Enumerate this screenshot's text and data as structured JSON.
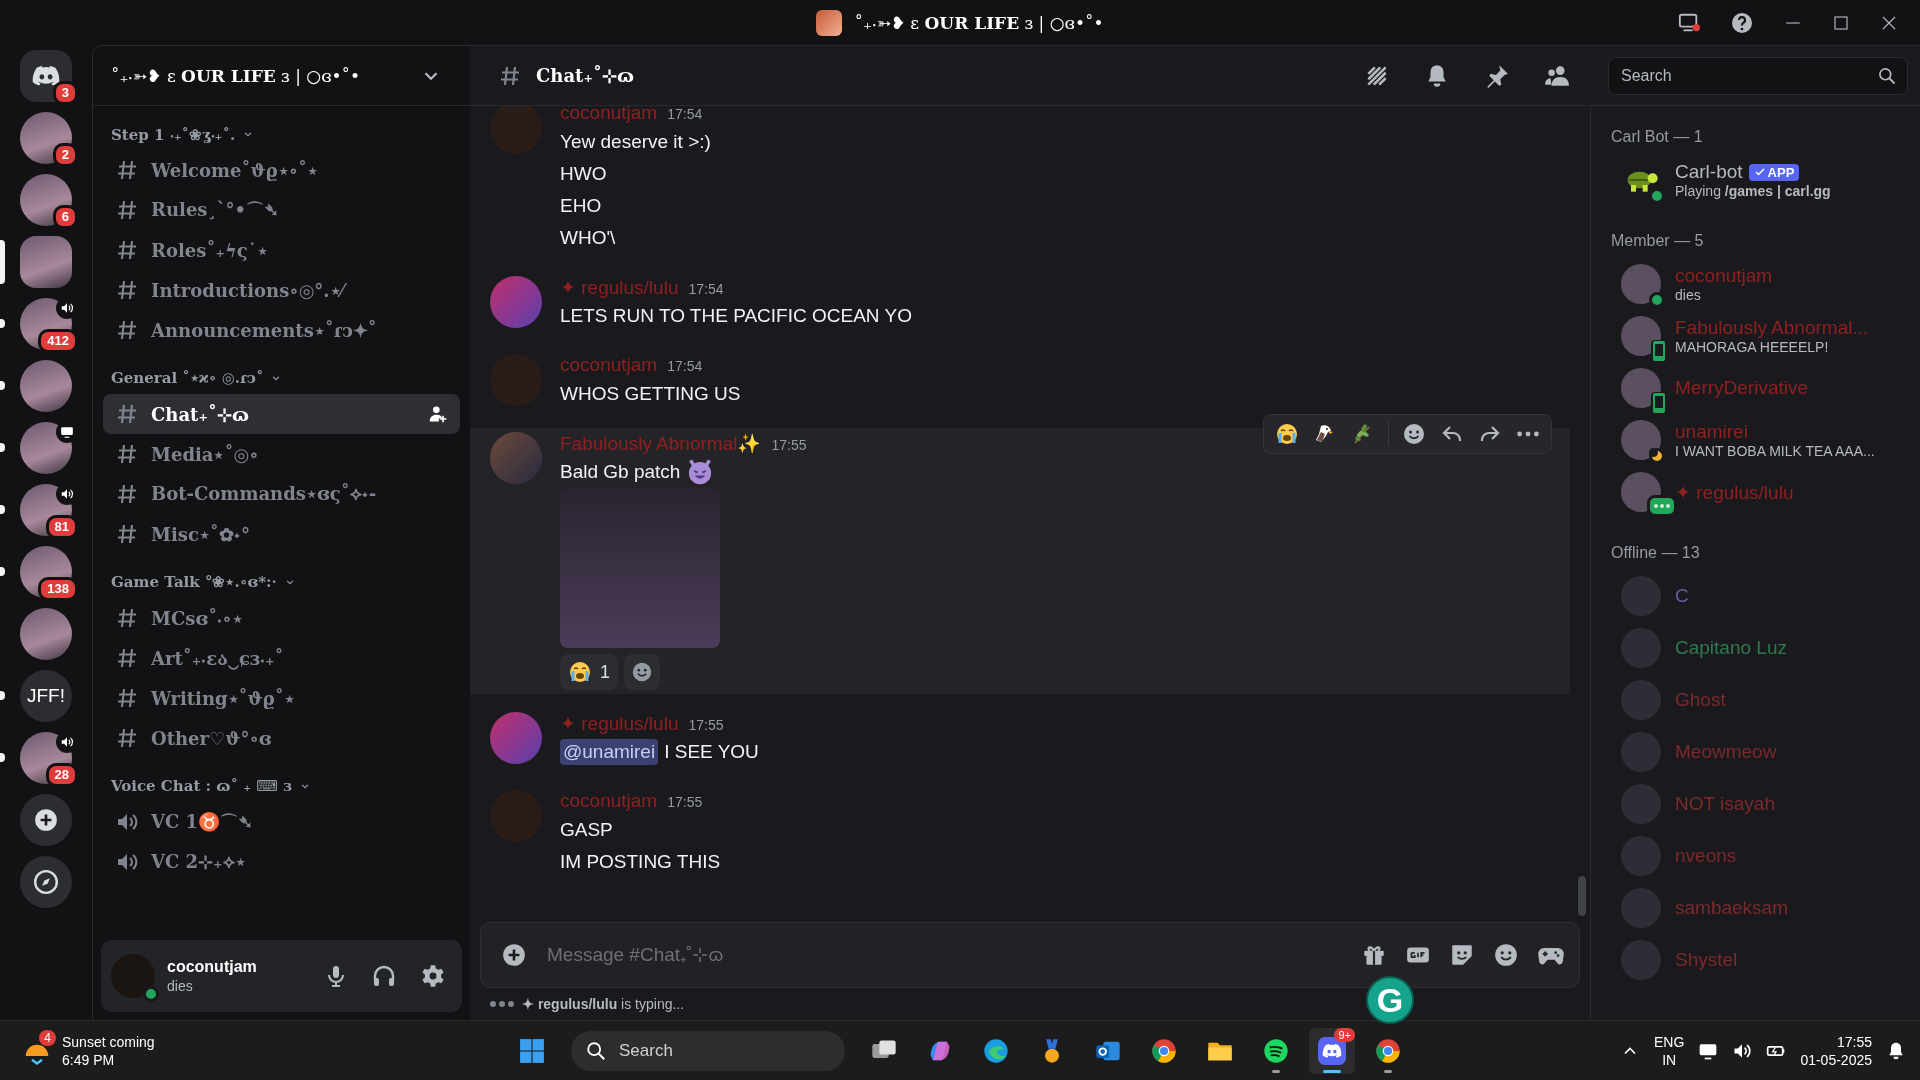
{
  "window": {
    "title": "˚₊‧➳❥ ɛ **OUR LIFE** ɜ | ○ɞ•˚•"
  },
  "rail": [
    {
      "kind": "home",
      "badge": "3",
      "selected": false,
      "unread": false
    },
    {
      "kind": "server",
      "badge": "2",
      "selected": false,
      "unread": false
    },
    {
      "kind": "server",
      "badge": "6",
      "selected": false,
      "unread": false
    },
    {
      "kind": "server",
      "selected": true,
      "unread": false
    },
    {
      "kind": "server",
      "badge": "412",
      "in_voice": true,
      "selected": false,
      "unread": true
    },
    {
      "kind": "server",
      "selected": false,
      "unread": true
    },
    {
      "kind": "server",
      "streaming": true,
      "selected": false,
      "unread": true
    },
    {
      "kind": "server",
      "badge": "81",
      "in_voice": true,
      "selected": false,
      "unread": true
    },
    {
      "kind": "server",
      "badge": "138",
      "selected": false,
      "unread": true
    },
    {
      "kind": "server",
      "selected": false,
      "unread": false
    },
    {
      "kind": "text",
      "label": "JFF!",
      "selected": false,
      "unread": true
    },
    {
      "kind": "server",
      "badge": "28",
      "in_voice": true,
      "selected": false,
      "unread": true
    },
    {
      "kind": "add",
      "selected": false,
      "unread": false
    },
    {
      "kind": "explore",
      "selected": false,
      "unread": false
    }
  ],
  "server": {
    "name": "˚₊‧➳❥ ɛ **OUR LIFE** ɜ | ○ɞ•˚•"
  },
  "categories": [
    {
      "name": "Step 1 ‧₊˚❀ʓ‧₊˚.",
      "expanded": true,
      "channels": [
        {
          "kind": "text",
          "name": "Welcome˚ϑϱ⋆∘˚⋆",
          "selected": false
        },
        {
          "kind": "text",
          "name": "Rules¸`°•⌒➴",
          "selected": false
        },
        {
          "kind": "text",
          "name": "Roles˚₊ϟς˙⋆",
          "selected": false
        },
        {
          "kind": "text",
          "name": "Introductions∘◎°.⋆⁄",
          "selected": false
        },
        {
          "kind": "text",
          "name": "Announcements⋆˚ɾↄ✦˚",
          "selected": false
        }
      ]
    },
    {
      "name": "General ˚⋆ϰ∘ ◎.ɾↄ˚",
      "expanded": true,
      "channels": [
        {
          "kind": "text",
          "name": "Chat₊˚⊹ɷ",
          "selected": true
        },
        {
          "kind": "text",
          "name": "Media⋆˚◎∘",
          "selected": false
        },
        {
          "kind": "text",
          "name": "Bot-Commands⋆ɞς˚⟡˖-",
          "selected": false
        },
        {
          "kind": "text",
          "name": "Misc⋆˚✿˖°",
          "selected": false
        }
      ]
    },
    {
      "name": "Game Talk °❀⋆.∘ɞ*:·",
      "expanded": true,
      "channels": [
        {
          "kind": "text",
          "name": "MCsɞ˚‧∘⋆",
          "selected": false
        },
        {
          "kind": "text",
          "name": "Art˚₊‧ɛა‿ɕɜ‧₊˚",
          "selected": false
        },
        {
          "kind": "text",
          "name": "Writing⋆˚ϑϱ˚⋆",
          "selected": false
        },
        {
          "kind": "text",
          "name": "Other♡ϑ°∘ɞ",
          "selected": false
        }
      ]
    },
    {
      "name": "Voice Chat : ɷ˚ ₊ ⌨ ɜ",
      "expanded": true,
      "channels": [
        {
          "kind": "voice",
          "name": "VC 1♉⌒➴",
          "selected": false
        },
        {
          "kind": "voice",
          "name": "VC 2⊹₊⟡⋆",
          "selected": false
        }
      ]
    }
  ],
  "user_panel": {
    "name": "coconutjam",
    "status_text": "dies",
    "presence": {
      "kind": "online"
    }
  },
  "header": {
    "channel": "Chat₊˚⊹ɷ",
    "search_placeholder": "Search"
  },
  "messages": [
    {
      "author": "coconutjam",
      "time": "17:54",
      "hovered": false,
      "lines": [
        {
          "text": "Yew deserve it >:)"
        },
        {
          "text": "HWO"
        },
        {
          "text": "EHO"
        },
        {
          "text": "WHO'\\"
        }
      ]
    },
    {
      "author": "✦ regulus/lulu",
      "time": "17:54",
      "hovered": false,
      "lines": [
        {
          "text": "LETS RUN TO THE PACIFIC OCEAN YO"
        }
      ]
    },
    {
      "author": "coconutjam",
      "time": "17:54",
      "hovered": false,
      "lines": [
        {
          "text": "WHOS GETTING US"
        }
      ]
    },
    {
      "author": "Fabulously Abnormal✨",
      "time": "17:55",
      "hovered": true,
      "lines": [
        {
          "text": "Bald Gb patch",
          "emoji": {
            "kind": "devil"
          }
        }
      ],
      "attachments": [
        {
          "kind": "image"
        }
      ],
      "reactions": [
        {
          "kind": "crying",
          "count": "1"
        }
      ]
    },
    {
      "author": "✦ regulus/lulu",
      "time": "17:55",
      "hovered": false,
      "lines": [
        {
          "mention": "@unamirei",
          "text": "I SEE YOU"
        }
      ]
    },
    {
      "author": "coconutjam",
      "time": "17:55",
      "hovered": false,
      "lines": [
        {
          "text": "GASP"
        },
        {
          "text": "IM POSTING THIS"
        }
      ]
    }
  ],
  "quick_reactions": [
    {
      "kind": "crying"
    },
    {
      "kind": "eagle"
    },
    {
      "kind": "plant"
    }
  ],
  "composer": {
    "placeholder": "Message #Chat₊˚⊹ɷ",
    "overlay_badge": "G"
  },
  "typing": "**✦ regulus/lulu** is typing...",
  "member_groups": [
    {
      "title": "Carl Bot — 1",
      "members": [
        {
          "name": "Carl-bot",
          "tag": "APP",
          "activity": "Playing **/games | carl.gg**",
          "presence": {
            "kind": "online"
          },
          "color": "#b5bac1"
        }
      ]
    },
    {
      "title": "Member — 5",
      "members": [
        {
          "name": "coconutjam",
          "activity": "dies",
          "presence": {
            "kind": "online"
          },
          "color": "#8e2020"
        },
        {
          "name": "Fabulously Abnormal...",
          "activity": "MAHORAGA HEEEELP!",
          "presence": {
            "kind": "mobile"
          },
          "color": "#8e2020"
        },
        {
          "name": "MerryDerivative",
          "presence": {
            "kind": "mobile"
          },
          "color": "#8e2020"
        },
        {
          "name": "unamirei",
          "activity": "I WANT BOBA MILK TEA AAA...",
          "presence": {
            "kind": "idle"
          },
          "color": "#8e2020"
        },
        {
          "name": "✦ regulus/lulu",
          "presence": {
            "kind": "typing"
          },
          "color": "#8e2020"
        }
      ]
    },
    {
      "title": "Offline — 13",
      "members": [
        {
          "name": "C",
          "presence": {
            "kind": "offline"
          },
          "color": "#6a58a0"
        },
        {
          "name": "Capitano Luz",
          "presence": {
            "kind": "offline"
          },
          "color": "#2f7a4c"
        },
        {
          "name": "Ghost",
          "presence": {
            "kind": "offline"
          },
          "color": "#7a2a2a"
        },
        {
          "name": "Meowmeow",
          "presence": {
            "kind": "offline"
          },
          "color": "#7a2a2a"
        },
        {
          "name": "NOT isayah",
          "presence": {
            "kind": "offline"
          },
          "color": "#7a2a2a"
        },
        {
          "name": "nveons",
          "presence": {
            "kind": "offline"
          },
          "color": "#7a2a2a"
        },
        {
          "name": "sambaeksam",
          "presence": {
            "kind": "offline"
          },
          "color": "#7a2a2a"
        },
        {
          "name": "Shystel",
          "presence": {
            "kind": "offline"
          },
          "color": "#7a2a2a"
        }
      ]
    }
  ],
  "taskbar": {
    "weather_badge": "4",
    "weather_title": "Sunset coming",
    "weather_time": "6:49 PM",
    "search_placeholder": "Search",
    "apps": [
      {
        "kind": "taskview",
        "running": false,
        "selected": false
      },
      {
        "kind": "copilot",
        "running": false,
        "selected": false
      },
      {
        "kind": "edge",
        "running": false,
        "selected": false
      },
      {
        "kind": "medal",
        "running": false,
        "selected": false
      },
      {
        "kind": "outlook",
        "running": false,
        "selected": false
      },
      {
        "kind": "chrome",
        "running": false,
        "selected": false
      },
      {
        "kind": "folder",
        "running": false,
        "selected": false
      },
      {
        "kind": "spotify",
        "running": true,
        "selected": false
      },
      {
        "kind": "discord",
        "running": true,
        "selected": true,
        "badge": "9+"
      },
      {
        "kind": "chrome-profile",
        "running": true,
        "selected": false
      }
    ],
    "lang": "ENG",
    "region": "IN",
    "time": "17:55",
    "date": "01-05-2025"
  }
}
